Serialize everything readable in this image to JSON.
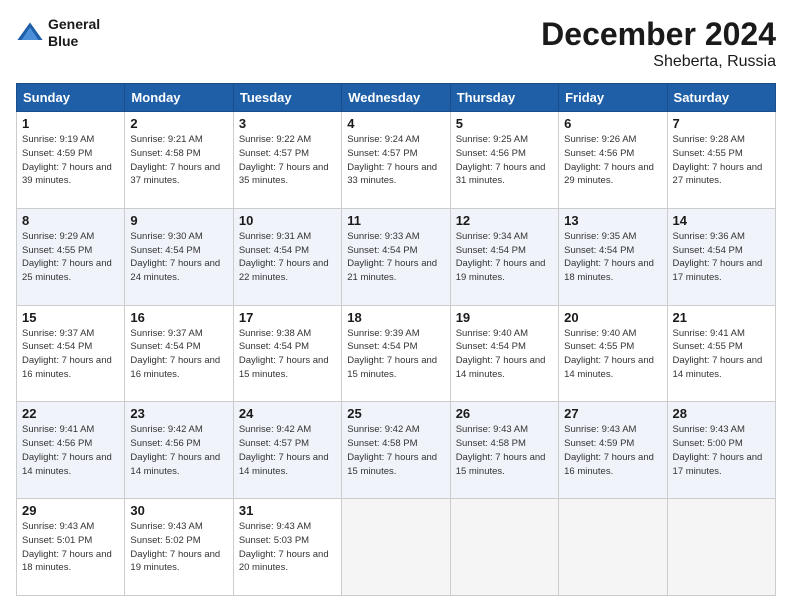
{
  "header": {
    "logo_line1": "General",
    "logo_line2": "Blue",
    "month_title": "December 2024",
    "location": "Sheberta, Russia"
  },
  "days_of_week": [
    "Sunday",
    "Monday",
    "Tuesday",
    "Wednesday",
    "Thursday",
    "Friday",
    "Saturday"
  ],
  "weeks": [
    [
      {
        "num": "1",
        "rise": "9:19 AM",
        "set": "4:59 PM",
        "daylight": "7 hours and 39 minutes."
      },
      {
        "num": "2",
        "rise": "9:21 AM",
        "set": "4:58 PM",
        "daylight": "7 hours and 37 minutes."
      },
      {
        "num": "3",
        "rise": "9:22 AM",
        "set": "4:57 PM",
        "daylight": "7 hours and 35 minutes."
      },
      {
        "num": "4",
        "rise": "9:24 AM",
        "set": "4:57 PM",
        "daylight": "7 hours and 33 minutes."
      },
      {
        "num": "5",
        "rise": "9:25 AM",
        "set": "4:56 PM",
        "daylight": "7 hours and 31 minutes."
      },
      {
        "num": "6",
        "rise": "9:26 AM",
        "set": "4:56 PM",
        "daylight": "7 hours and 29 minutes."
      },
      {
        "num": "7",
        "rise": "9:28 AM",
        "set": "4:55 PM",
        "daylight": "7 hours and 27 minutes."
      }
    ],
    [
      {
        "num": "8",
        "rise": "9:29 AM",
        "set": "4:55 PM",
        "daylight": "7 hours and 25 minutes."
      },
      {
        "num": "9",
        "rise": "9:30 AM",
        "set": "4:54 PM",
        "daylight": "7 hours and 24 minutes."
      },
      {
        "num": "10",
        "rise": "9:31 AM",
        "set": "4:54 PM",
        "daylight": "7 hours and 22 minutes."
      },
      {
        "num": "11",
        "rise": "9:33 AM",
        "set": "4:54 PM",
        "daylight": "7 hours and 21 minutes."
      },
      {
        "num": "12",
        "rise": "9:34 AM",
        "set": "4:54 PM",
        "daylight": "7 hours and 19 minutes."
      },
      {
        "num": "13",
        "rise": "9:35 AM",
        "set": "4:54 PM",
        "daylight": "7 hours and 18 minutes."
      },
      {
        "num": "14",
        "rise": "9:36 AM",
        "set": "4:54 PM",
        "daylight": "7 hours and 17 minutes."
      }
    ],
    [
      {
        "num": "15",
        "rise": "9:37 AM",
        "set": "4:54 PM",
        "daylight": "7 hours and 16 minutes."
      },
      {
        "num": "16",
        "rise": "9:37 AM",
        "set": "4:54 PM",
        "daylight": "7 hours and 16 minutes."
      },
      {
        "num": "17",
        "rise": "9:38 AM",
        "set": "4:54 PM",
        "daylight": "7 hours and 15 minutes."
      },
      {
        "num": "18",
        "rise": "9:39 AM",
        "set": "4:54 PM",
        "daylight": "7 hours and 15 minutes."
      },
      {
        "num": "19",
        "rise": "9:40 AM",
        "set": "4:54 PM",
        "daylight": "7 hours and 14 minutes."
      },
      {
        "num": "20",
        "rise": "9:40 AM",
        "set": "4:55 PM",
        "daylight": "7 hours and 14 minutes."
      },
      {
        "num": "21",
        "rise": "9:41 AM",
        "set": "4:55 PM",
        "daylight": "7 hours and 14 minutes."
      }
    ],
    [
      {
        "num": "22",
        "rise": "9:41 AM",
        "set": "4:56 PM",
        "daylight": "7 hours and 14 minutes."
      },
      {
        "num": "23",
        "rise": "9:42 AM",
        "set": "4:56 PM",
        "daylight": "7 hours and 14 minutes."
      },
      {
        "num": "24",
        "rise": "9:42 AM",
        "set": "4:57 PM",
        "daylight": "7 hours and 14 minutes."
      },
      {
        "num": "25",
        "rise": "9:42 AM",
        "set": "4:58 PM",
        "daylight": "7 hours and 15 minutes."
      },
      {
        "num": "26",
        "rise": "9:43 AM",
        "set": "4:58 PM",
        "daylight": "7 hours and 15 minutes."
      },
      {
        "num": "27",
        "rise": "9:43 AM",
        "set": "4:59 PM",
        "daylight": "7 hours and 16 minutes."
      },
      {
        "num": "28",
        "rise": "9:43 AM",
        "set": "5:00 PM",
        "daylight": "7 hours and 17 minutes."
      }
    ],
    [
      {
        "num": "29",
        "rise": "9:43 AM",
        "set": "5:01 PM",
        "daylight": "7 hours and 18 minutes."
      },
      {
        "num": "30",
        "rise": "9:43 AM",
        "set": "5:02 PM",
        "daylight": "7 hours and 19 minutes."
      },
      {
        "num": "31",
        "rise": "9:43 AM",
        "set": "5:03 PM",
        "daylight": "7 hours and 20 minutes."
      },
      null,
      null,
      null,
      null
    ]
  ]
}
